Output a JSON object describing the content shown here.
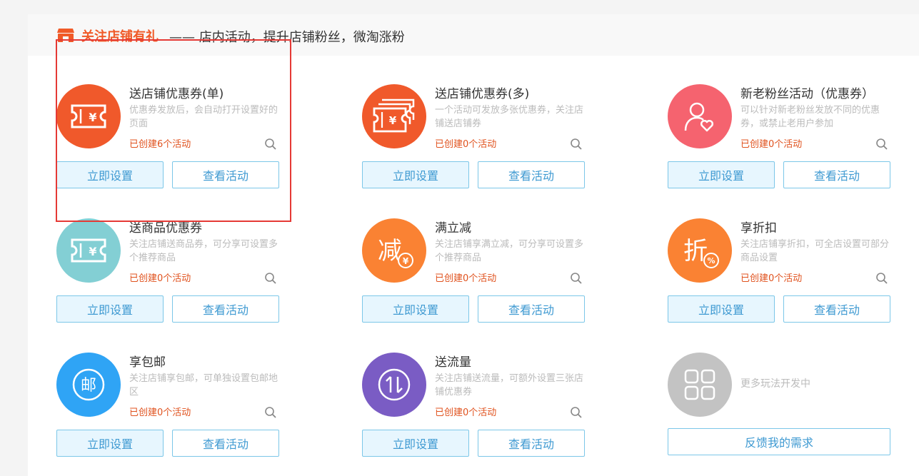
{
  "header": {
    "title": "关注店铺有礼",
    "subtitle": "—— 店内活动，提升店铺粉丝，微淘涨粉",
    "icon": "shop-icon"
  },
  "colors": {
    "brand": "#f05a28",
    "button_border": "#7cc7e8",
    "button_text": "#3f9ad2",
    "button_fill": "#e7f6fe",
    "count_text": "#e0521e",
    "highlight": "#e53935"
  },
  "cards": [
    {
      "title": "送店铺优惠券(单)",
      "desc": "优惠券发放后，会自动打开设置好的页面",
      "count": "已创建6个活动",
      "setup": "立即设置",
      "view": "查看活动",
      "icon": "coupon-icon",
      "color": "#f0592b"
    },
    {
      "title": "送店铺优惠券(多)",
      "desc": "一个活动可发放多张优惠券，关注店铺送店铺券",
      "count": "已创建0个活动",
      "setup": "立即设置",
      "view": "查看活动",
      "icon": "multi-coupon-icon",
      "color": "#f0592b"
    },
    {
      "title": "新老粉丝活动（优惠券）",
      "desc": "可以针对新老粉丝发放不同的优惠券，或禁止老用户参加",
      "count": "已创建0个活动",
      "setup": "立即设置",
      "view": "查看活动",
      "icon": "fan-heart-icon",
      "color": "#f5636f"
    },
    {
      "title": "送商品优惠券",
      "desc": "关注店铺送商品券，可分享可设置多个推荐商品",
      "count": "已创建0个活动",
      "setup": "立即设置",
      "view": "查看活动",
      "icon": "product-coupon-icon",
      "color": "#83cfd4"
    },
    {
      "title": "满立减",
      "desc": "关注店铺享满立减，可分享可设置多个推荐商品",
      "count": "已创建0个活动",
      "setup": "立即设置",
      "view": "查看活动",
      "icon": "discount-reduce-icon",
      "color": "#fa8233",
      "glyph": "减"
    },
    {
      "title": "享折扣",
      "desc": "关注店铺享折扣，可全店设置可部分商品设置",
      "count": "已创建0个活动",
      "setup": "立即设置",
      "view": "查看活动",
      "icon": "percent-discount-icon",
      "color": "#fa8233",
      "glyph": "折"
    },
    {
      "title": "享包邮",
      "desc": "关注店铺享包邮，可单独设置包邮地区",
      "count": "已创建0个活动",
      "setup": "立即设置",
      "view": "查看活动",
      "icon": "free-shipping-icon",
      "color": "#2fa4f5",
      "glyph": "邮"
    },
    {
      "title": "送流量",
      "desc": "关注店铺送流量，可额外设置三张店铺优惠券",
      "count": "已创建0个活动",
      "setup": "立即设置",
      "view": "查看活动",
      "icon": "data-traffic-icon",
      "color": "#7a5cc4"
    }
  ],
  "more": {
    "text": "更多玩法开发中",
    "feedback": "反馈我的需求",
    "icon": "grid-icon",
    "color": "#c3c3c3"
  }
}
